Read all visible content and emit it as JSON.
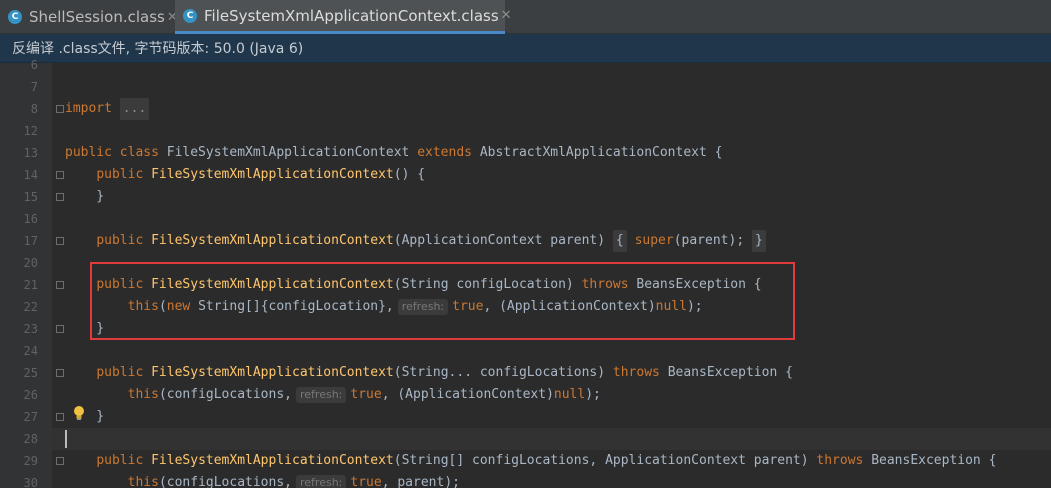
{
  "tabs": [
    {
      "label": "ShellSession.class",
      "icon": "class-file-icon",
      "active": false
    },
    {
      "label": "FileSystemXmlApplicationContext.class",
      "icon": "class-file-icon",
      "active": true
    }
  ],
  "banner": {
    "text": "反编译 .class文件, 字节码版本: 50.0 (Java 6)"
  },
  "lines": [
    {
      "num": "6"
    },
    {
      "num": "7"
    },
    {
      "num": "8",
      "tokens": [
        {
          "c": "kw",
          "t": "import "
        },
        {
          "c": "dots",
          "t": "..."
        }
      ]
    },
    {
      "num": "12"
    },
    {
      "num": "13",
      "tokens": [
        {
          "c": "kw",
          "t": "public class "
        },
        {
          "c": "tx",
          "t": "FileSystemXmlApplicationContext "
        },
        {
          "c": "kw",
          "t": "extends "
        },
        {
          "c": "tx",
          "t": "AbstractXmlApplicationContext {"
        }
      ]
    },
    {
      "num": "14",
      "tokens": [
        {
          "c": "tx",
          "t": "    "
        },
        {
          "c": "kw",
          "t": "public "
        },
        {
          "c": "fn",
          "t": "FileSystemXmlApplicationContext"
        },
        {
          "c": "tx",
          "t": "() {"
        }
      ]
    },
    {
      "num": "15",
      "tokens": [
        {
          "c": "tx",
          "t": "    }"
        }
      ]
    },
    {
      "num": "16"
    },
    {
      "num": "17",
      "tokens": [
        {
          "c": "tx",
          "t": "    "
        },
        {
          "c": "kw",
          "t": "public "
        },
        {
          "c": "fn",
          "t": "FileSystemXmlApplicationContext"
        },
        {
          "c": "tx",
          "t": "(ApplicationContext parent) "
        },
        {
          "c": "fbox",
          "t": "{"
        },
        {
          "c": "tx",
          "t": " "
        },
        {
          "c": "kw",
          "t": "super"
        },
        {
          "c": "tx",
          "t": "(parent); "
        },
        {
          "c": "fbox",
          "t": "}"
        }
      ]
    },
    {
      "num": "20"
    },
    {
      "num": "21",
      "tokens": [
        {
          "c": "tx",
          "t": "    "
        },
        {
          "c": "kw",
          "t": "public "
        },
        {
          "c": "fn",
          "t": "FileSystemXmlApplicationContext"
        },
        {
          "c": "tx",
          "t": "(String configLocation) "
        },
        {
          "c": "kw",
          "t": "throws "
        },
        {
          "c": "tx",
          "t": "BeansException {"
        }
      ]
    },
    {
      "num": "22",
      "tokens": [
        {
          "c": "tx",
          "t": "        "
        },
        {
          "c": "kw",
          "t": "this"
        },
        {
          "c": "tx",
          "t": "("
        },
        {
          "c": "kw",
          "t": "new "
        },
        {
          "c": "tx",
          "t": "String[]{configLocation},"
        },
        {
          "c": "hint",
          "t": "refresh:"
        },
        {
          "c": "kw",
          "t": "true"
        },
        {
          "c": "tx",
          "t": ", (ApplicationContext)"
        },
        {
          "c": "kw",
          "t": "null"
        },
        {
          "c": "tx",
          "t": ");"
        }
      ]
    },
    {
      "num": "23",
      "tokens": [
        {
          "c": "tx",
          "t": "    }"
        }
      ]
    },
    {
      "num": "24"
    },
    {
      "num": "25",
      "tokens": [
        {
          "c": "tx",
          "t": "    "
        },
        {
          "c": "kw",
          "t": "public "
        },
        {
          "c": "fn",
          "t": "FileSystemXmlApplicationContext"
        },
        {
          "c": "tx",
          "t": "(String... configLocations) "
        },
        {
          "c": "kw",
          "t": "throws "
        },
        {
          "c": "tx",
          "t": "BeansException {"
        }
      ]
    },
    {
      "num": "26",
      "tokens": [
        {
          "c": "tx",
          "t": "        "
        },
        {
          "c": "kw",
          "t": "this"
        },
        {
          "c": "tx",
          "t": "(configLocations,"
        },
        {
          "c": "hint",
          "t": "refresh:"
        },
        {
          "c": "kw",
          "t": "true"
        },
        {
          "c": "tx",
          "t": ", (ApplicationContext)"
        },
        {
          "c": "kw",
          "t": "null"
        },
        {
          "c": "tx",
          "t": ");"
        }
      ]
    },
    {
      "num": "27",
      "tokens": [
        {
          "c": "tx",
          "t": "    }"
        }
      ]
    },
    {
      "num": "28"
    },
    {
      "num": "29",
      "tokens": [
        {
          "c": "tx",
          "t": "    "
        },
        {
          "c": "kw",
          "t": "public "
        },
        {
          "c": "fn",
          "t": "FileSystemXmlApplicationContext"
        },
        {
          "c": "tx",
          "t": "(String[] configLocations, ApplicationContext parent) "
        },
        {
          "c": "kw",
          "t": "throws "
        },
        {
          "c": "tx",
          "t": "BeansException {"
        }
      ]
    },
    {
      "num": "30",
      "tokens": [
        {
          "c": "tx",
          "t": "        "
        },
        {
          "c": "kw",
          "t": "this"
        },
        {
          "c": "tx",
          "t": "(configLocations,"
        },
        {
          "c": "hint",
          "t": "refresh:"
        },
        {
          "c": "kw",
          "t": "true"
        },
        {
          "c": "tx",
          "t": ", parent);"
        }
      ]
    }
  ],
  "colors": {
    "keyword": "#cc7832",
    "method": "#ffc66d",
    "text": "#a9b7c6",
    "highlight_box": "#e03c3c"
  },
  "icons": {
    "tab": "class-file-icon",
    "gutter_hint": "lightbulb-icon",
    "fold": "fold-marker-icon"
  }
}
